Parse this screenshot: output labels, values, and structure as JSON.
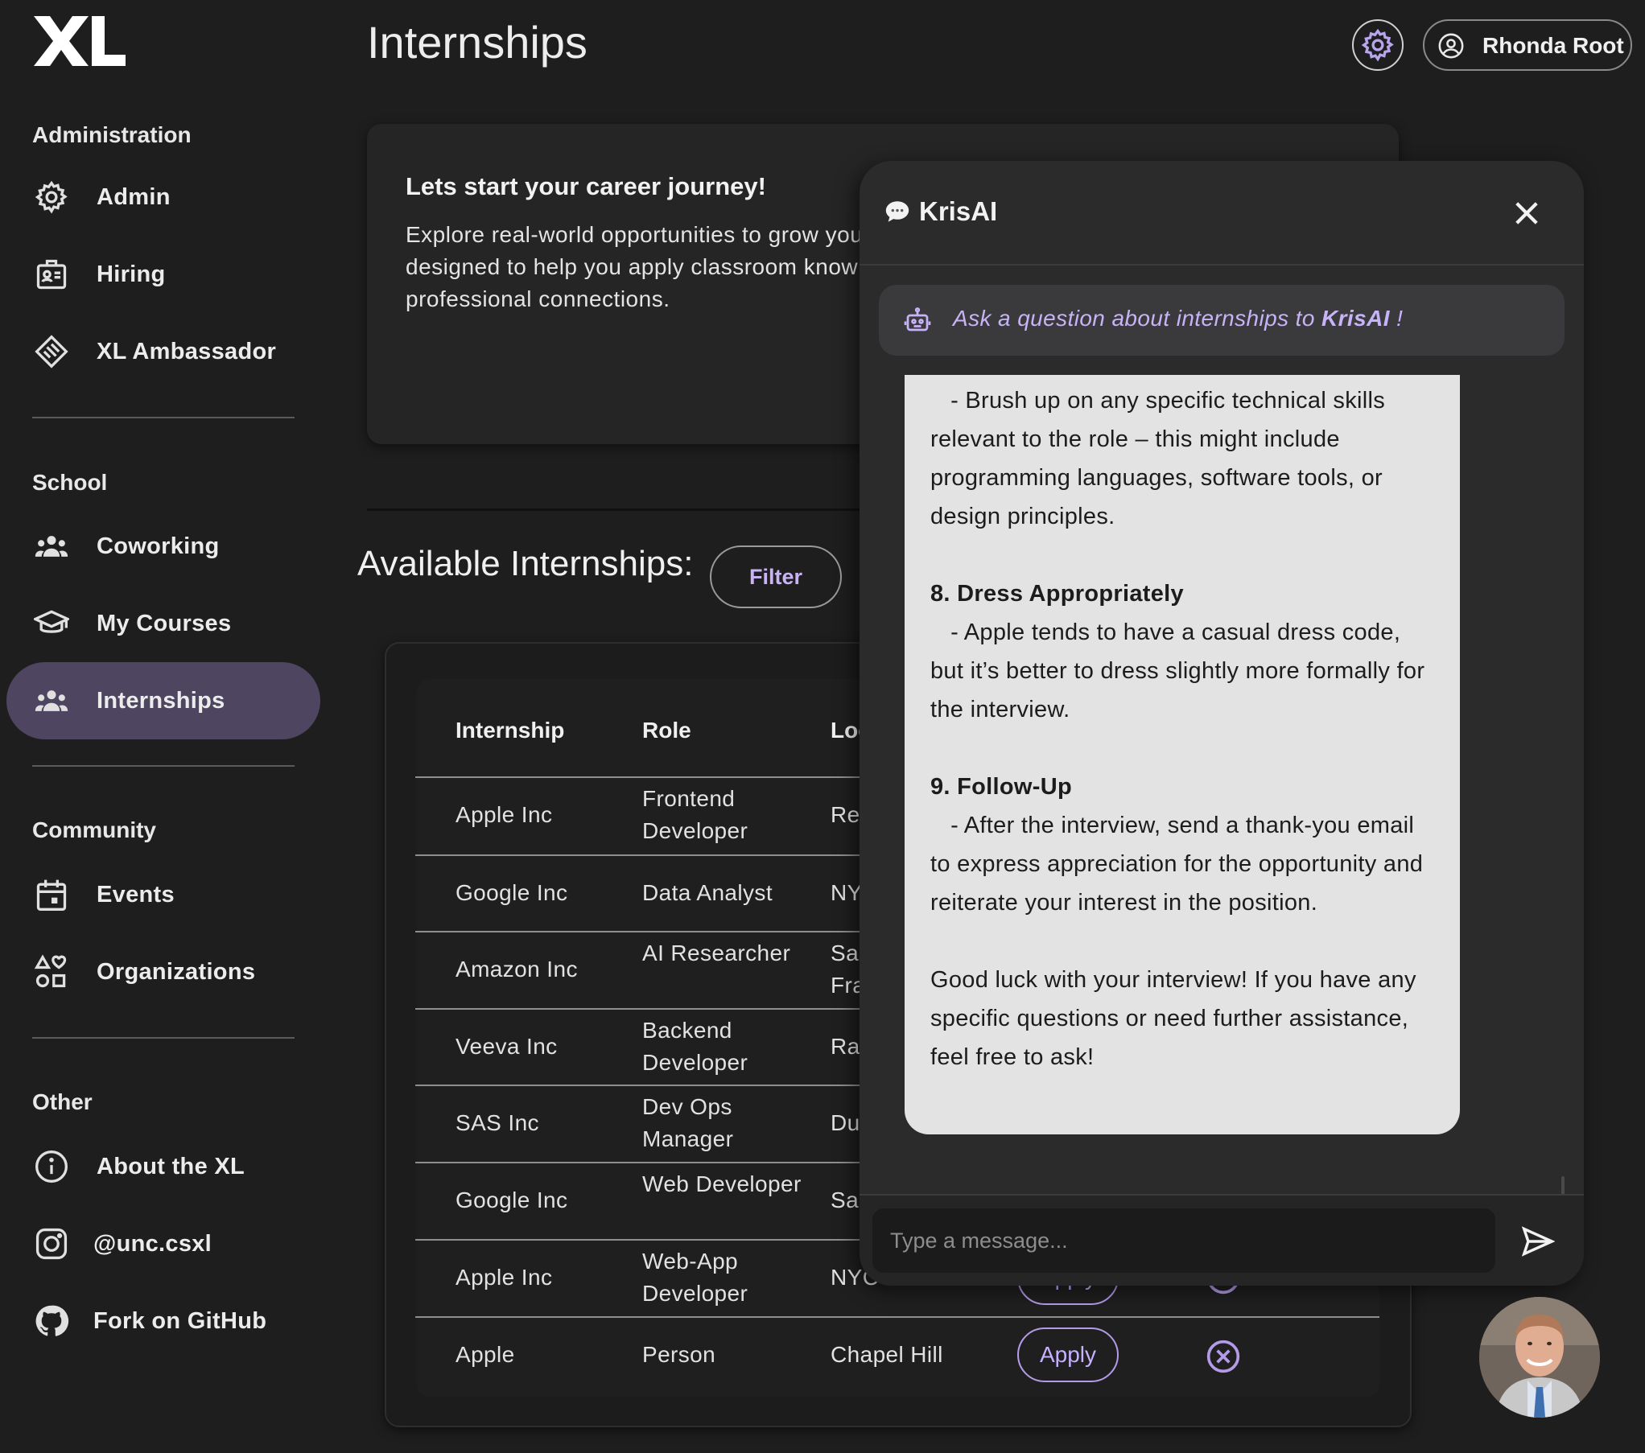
{
  "sidebar": {
    "sections": [
      {
        "title": "Administration",
        "items": [
          {
            "label": "Admin",
            "icon": "gear-icon"
          },
          {
            "label": "Hiring",
            "icon": "id-badge-icon"
          },
          {
            "label": "XL Ambassador",
            "icon": "handshake-icon"
          }
        ]
      },
      {
        "title": "School",
        "items": [
          {
            "label": "Coworking",
            "icon": "group-icon"
          },
          {
            "label": "My Courses",
            "icon": "graduation-cap-icon"
          },
          {
            "label": "Internships",
            "icon": "group-icon",
            "active": true
          }
        ]
      },
      {
        "title": "Community",
        "items": [
          {
            "label": "Events",
            "icon": "calendar-icon"
          },
          {
            "label": "Organizations",
            "icon": "shapes-icon"
          }
        ]
      },
      {
        "title": "Other",
        "items": [
          {
            "label": "About the XL",
            "icon": "info-icon"
          },
          {
            "label": "@unc.csxl",
            "icon": "instagram-icon"
          },
          {
            "label": "Fork on GitHub",
            "icon": "github-icon"
          }
        ]
      }
    ]
  },
  "header": {
    "title": "Internships",
    "user_name": "Rhonda Root"
  },
  "intro": {
    "title": "Lets start your career journey!",
    "text": "Explore real-world opportunities to grow your career. Discover internships offered through designed to help you apply classroom knowledge, hands-on experience, and build professional connections."
  },
  "available": {
    "title": "Available Internships:",
    "filter_label": "Filter"
  },
  "table": {
    "columns": [
      "Internship",
      "Role",
      "Location"
    ],
    "rows": [
      {
        "company": "Apple Inc",
        "role": "Frontend Developer",
        "location": "Remote"
      },
      {
        "company": "Google Inc",
        "role": "Data Analyst",
        "location": "NYC"
      },
      {
        "company": "Amazon Inc",
        "role": "AI Researcher",
        "location": "San Francisco"
      },
      {
        "company": "Veeva Inc",
        "role": "Backend Developer",
        "location": "Raleigh"
      },
      {
        "company": "SAS Inc",
        "role": "Dev Ops Manager",
        "location": "Durham"
      },
      {
        "company": "Google Inc",
        "role": "Web Developer",
        "location": "San Jose"
      },
      {
        "company": "Apple Inc",
        "role": "Web-App Developer",
        "location": "NYC"
      },
      {
        "company": "Apple",
        "role": "Person",
        "location": "Chapel Hill"
      }
    ],
    "apply_label": "Apply"
  },
  "chat": {
    "title": "KrisAI",
    "prompt_prefix": "Ask a question about internships to ",
    "prompt_name": "KrisAI",
    "prompt_suffix": " !",
    "message": {
      "p1": "   - Brush up on any specific technical skills relevant to the role – this might include programming languages, software tools, or design principles.",
      "h8": "8. Dress Appropriately",
      "p8": "   - Apple tends to have a casual dress code, but it’s better to dress slightly more formally for the interview.",
      "h9": "9. Follow-Up",
      "p9": "   - After the interview, send a thank-you email to express appreciation for the opportunity and reiterate your interest in the position.",
      "closing": "Good luck with your interview! If you have any specific questions or need further assistance, feel free to ask!"
    },
    "input_placeholder": "Type a message..."
  },
  "colors": {
    "background": "#1e1e1e",
    "accent": "#c7b0ff",
    "active_nav": "#4e4560",
    "chat_bg": "#2b2b2b",
    "message_bg": "#e3e3e3"
  }
}
